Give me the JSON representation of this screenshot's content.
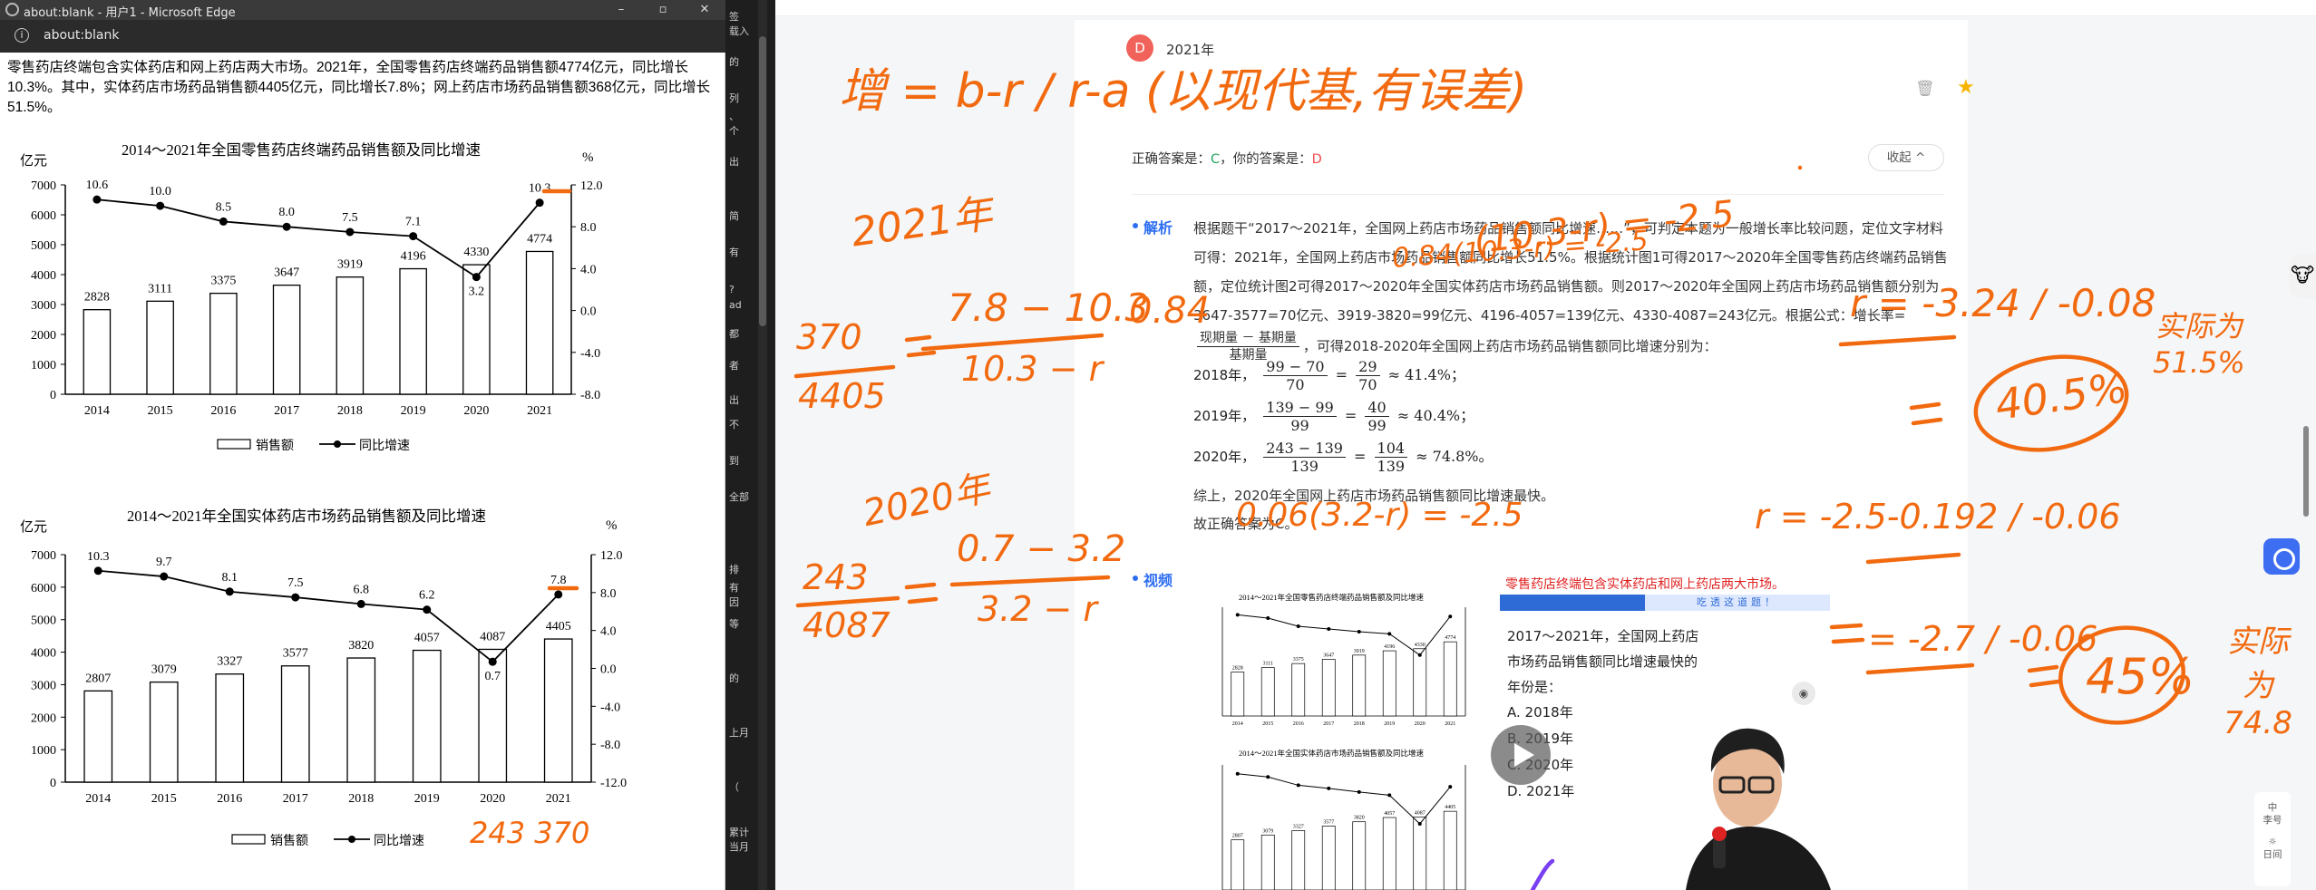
{
  "browser": {
    "title": "about:blank - 用户1 - Microsoft Edge",
    "url": "about:blank",
    "controls": {
      "min": "–",
      "restore": "▫",
      "close": "✕"
    }
  },
  "passage": "零售药店终端包含实体药店和网上药店两大市场。2021年，全国零售药店终端药品销售额4774亿元，同比增长10.3%。其中，实体药店市场药品销售额4405亿元，同比增长7.8%；网上药店市场药品销售额368亿元，同比增长51.5%。",
  "strip_fragments": [
    "签\n载入",
    "的",
    "列",
    "、\n个",
    "出",
    "简",
    "有",
    "\n?",
    "ad",
    "都",
    "者",
    "\n出",
    "不",
    "到",
    "全部",
    "排",
    "有\n因",
    "等",
    "的",
    "上月",
    "（",
    "累计\n当月"
  ],
  "chart_data": [
    {
      "type": "bar",
      "title": "2014～2021年全国零售药店终端药品销售额及同比增速",
      "left_unit": "亿元",
      "right_unit": "%",
      "categories": [
        "2014",
        "2015",
        "2016",
        "2017",
        "2018",
        "2019",
        "2020",
        "2021"
      ],
      "left_ticks": [
        "0",
        "1000",
        "2000",
        "3000",
        "4000",
        "5000",
        "6000",
        "7000"
      ],
      "right_ticks": [
        "12.0",
        "8.0",
        "4.0",
        "0.0",
        "-4.0",
        "-8.0"
      ],
      "ylim": [
        0,
        7000
      ],
      "y2lim": [
        -8,
        12
      ],
      "series": [
        {
          "name": "销售额",
          "type": "bar",
          "values": [
            2828,
            3111,
            3375,
            3647,
            3919,
            4196,
            4330,
            4774
          ],
          "labels": [
            "2828",
            "3111",
            "3375",
            "3647",
            "3919",
            "4196",
            "4330",
            "4774"
          ]
        },
        {
          "name": "同比增速",
          "type": "line",
          "values": [
            10.6,
            10.0,
            8.5,
            8.0,
            7.5,
            7.1,
            3.2,
            10.3
          ],
          "labels": [
            "10.6",
            "10.0",
            "8.5",
            "8.0",
            "7.5",
            "7.1",
            "3.2",
            "10.3"
          ]
        }
      ]
    },
    {
      "type": "bar",
      "title": "2014～2021年全国实体药店市场药品销售额及同比增速",
      "left_unit": "亿元",
      "right_unit": "%",
      "categories": [
        "2014",
        "2015",
        "2016",
        "2017",
        "2018",
        "2019",
        "2020",
        "2021"
      ],
      "left_ticks": [
        "0",
        "1000",
        "2000",
        "3000",
        "4000",
        "5000",
        "6000",
        "7000"
      ],
      "right_ticks": [
        "12.0",
        "8.0",
        "4.0",
        "0.0",
        "-4.0",
        "-8.0",
        "-12.0"
      ],
      "ylim": [
        0,
        7000
      ],
      "y2lim": [
        -12,
        12
      ],
      "series": [
        {
          "name": "销售额",
          "type": "bar",
          "values": [
            2807,
            3079,
            3327,
            3577,
            3820,
            4057,
            4087,
            4405
          ],
          "labels": [
            "2807",
            "3079",
            "3327",
            "3577",
            "3820",
            "4057",
            "4087",
            "4405"
          ]
        },
        {
          "name": "同比增速",
          "type": "line",
          "values": [
            10.3,
            9.7,
            8.1,
            7.5,
            6.8,
            6.2,
            0.7,
            7.8
          ],
          "labels": [
            "10.3",
            "9.7",
            "8.1",
            "7.5",
            "6.8",
            "6.2",
            "0.7",
            "7.8"
          ]
        }
      ]
    }
  ],
  "question": {
    "avatar_letter": "D",
    "year": "2021年",
    "correct_label": "正确答案是：",
    "correct": "C",
    "yours_label": "，你的答案是：",
    "yours": "D",
    "collapse": "收起",
    "collapse_icon": "^",
    "trash_icon": "trash-icon",
    "star_icon": "star-icon",
    "analysis_label": "解析",
    "analysis_p1": "根据题干“2017～2021年，全国网上药店市场药品销售额同比增速……”，可判定本题为一般增长率比较问题，定位文字材料可得：2021年，全国网上药店市场药品销售额同比增长51.5%。根据统计图1可得2017～2020年全国零售药店终端药品销售额，定位统计图2可得2017～2020年全国实体药店市场药品销售额。则2017～2020年全国网上药店市场药品销售额分别为3647-3577=70亿元、3919-3820=99亿元、4196-4057=139亿元、4330-4087=243亿元。根据公式：增长率=",
    "formula_num": "现期量 － 基期量",
    "formula_den": "基期量",
    "formula_tail": "，可得2018-2020年全国网上药店市场药品销售额同比增速分别为：",
    "rows": [
      {
        "year": "2018年，",
        "n1": "99 − 70",
        "d1": "70",
        "n2": "29",
        "d2": "70",
        "approx": "≈ 41.4%；"
      },
      {
        "year": "2019年，",
        "n1": "139 − 99",
        "d1": "99",
        "n2": "40",
        "d2": "99",
        "approx": "≈ 40.4%；"
      },
      {
        "year": "2020年，",
        "n1": "243 − 139",
        "d1": "139",
        "n2": "104",
        "d2": "139",
        "approx": "≈ 74.8%。"
      }
    ],
    "summary": "综上，2020年全国网上药店市场药品销售额同比增速最快。",
    "conclusion": "故正确答案为C。",
    "video_label": "视频"
  },
  "video": {
    "banner_title": "零售药店终端包含实体药店和网上药店两大市场。",
    "banner_sub": "吃透这道题！",
    "question": "2017～2021年，全国网上药店市场药品销售额同比增速最快的年份是：",
    "options": [
      "A. 2018年",
      "B. 2019年",
      "C. 2020年",
      "D. 2021年"
    ],
    "eye_icon": "eye-icon",
    "thumb_chart1_title": "2014～2021年全国零售药店终端药品销售额及同比增速",
    "thumb_chart2_title": "2014～2021年全国实体药店市场药品销售额及同比增速"
  },
  "side_tools": [
    "中\n李号",
    "☼\n日间"
  ],
  "ink": {
    "formula": "增 = b-r / r-a (以现代基,有误差)",
    "y2021": "2021年",
    "frac1_num": "370",
    "frac1_den": "4405",
    "eq1_num": "7.8 − 10.3",
    "eq1_den": "10.3 − r",
    "eq1_rhs": "0.84",
    "top_row": "(10.3-r) = -2.5",
    "mid_row": "0.84(10.3-r) = -2.5",
    "r1": "r = -3.24 / -0.08",
    "r1_ans": "40.5%",
    "real1": "实际为 51.5%",
    "y2020": "2020年",
    "frac2_num": "243",
    "frac2_den": "4087",
    "eq2_num": "0.7 − 3.2",
    "eq2_den": "3.2 − r",
    "row2": "0.06(3.2-r) = -2.5",
    "r2": "r = -2.5-0.192 / -0.06",
    "r2b": "= -2.7 / -0.06",
    "r2_ans": "45%",
    "real2": "实际为 74.8",
    "chart_note": "243   370"
  }
}
